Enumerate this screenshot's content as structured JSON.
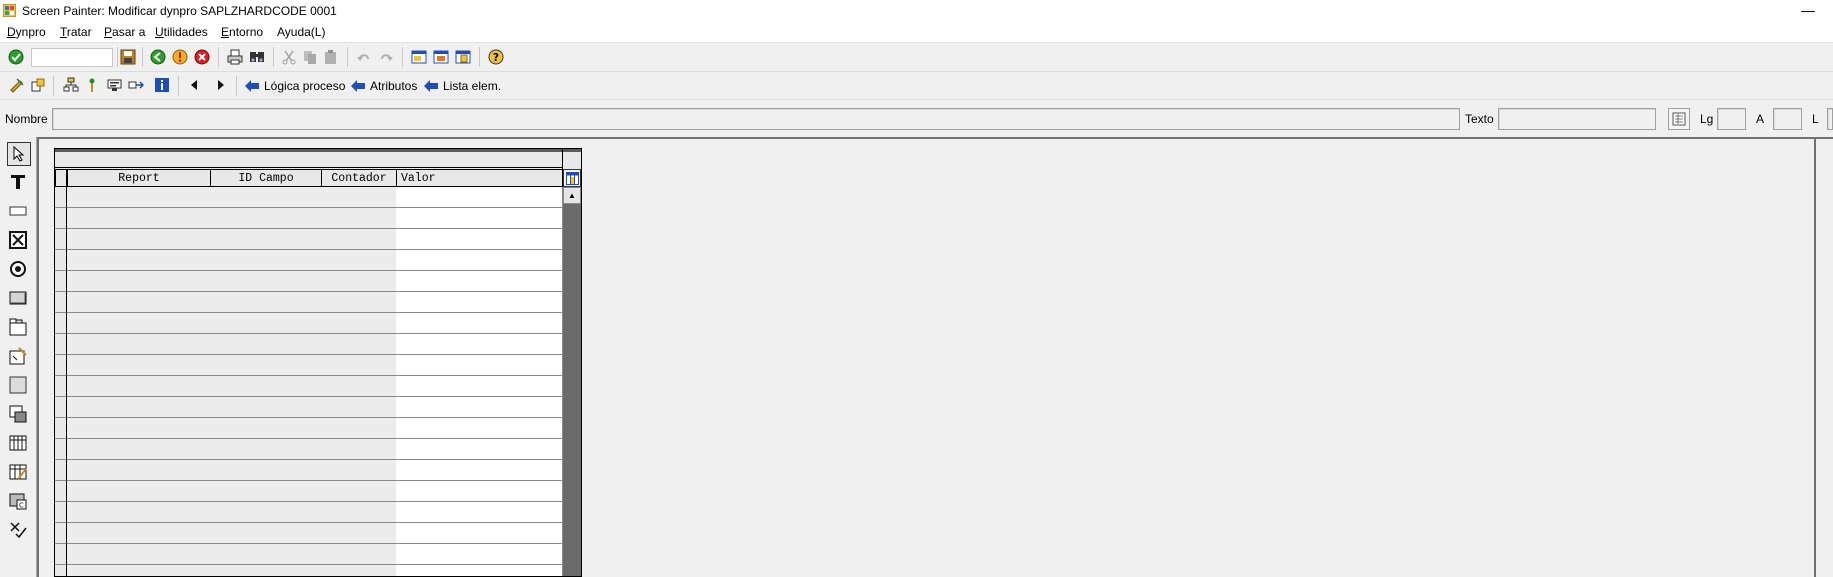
{
  "window": {
    "title": "Screen Painter:  Modificar dynpro SAPLZHARDCODE 0001",
    "minimize_glyph": "—"
  },
  "menu": [
    {
      "label_ul": "D",
      "label_rest": "ynpro"
    },
    {
      "label_ul": "T",
      "label_rest": "ratar"
    },
    {
      "label_ul": "P",
      "label_rest": "asar a"
    },
    {
      "label_ul": "U",
      "label_rest": "tilidades"
    },
    {
      "label_ul": "E",
      "label_rest": "ntorno"
    },
    {
      "label_ul": "",
      "label_rest": "Ayuda(L)"
    }
  ],
  "toolbar2": {
    "logica_label": "Lógica proceso",
    "atributos_label": "Atributos",
    "lista_label": "Lista elem."
  },
  "namerow": {
    "nombre_label": "Nombre",
    "texto_label": "Texto",
    "lg_label": "Lg",
    "a_label": "A",
    "l_label": "L",
    "nombre_value": "",
    "texto_value": ""
  },
  "table": {
    "columns": [
      "Report",
      "ID Campo",
      "Contador",
      "Valor"
    ],
    "row_count": 19
  },
  "colors": {
    "accent_blue": "#1f4fb4",
    "confirm_green": "#2e9c2e",
    "cancel_red": "#d42020",
    "scroll_dark": "#6b6b6b"
  }
}
